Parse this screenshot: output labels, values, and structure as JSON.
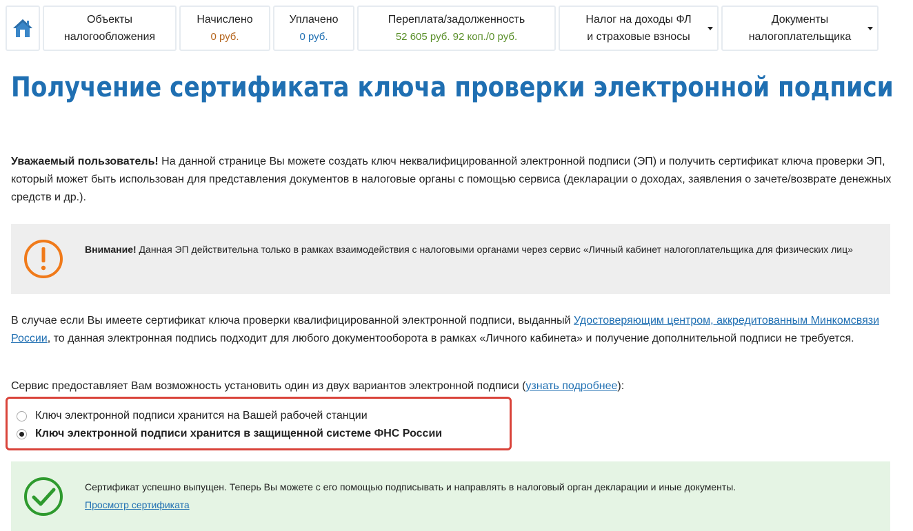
{
  "nav": {
    "home_label": "home",
    "objects": {
      "line1": "Объекты",
      "line2": "налогообложения"
    },
    "accrued": {
      "line1": "Начислено",
      "line2": "0 руб."
    },
    "paid": {
      "line1": "Уплачено",
      "line2": "0 руб."
    },
    "balance": {
      "line1": "Переплата/задолженность",
      "line2": "52 605 руб. 92 коп./0 руб."
    },
    "tax": {
      "line1": "Налог на доходы ФЛ",
      "line2": "и страховые взносы"
    },
    "docs": {
      "line1": "Документы",
      "line2": "налогоплательщика"
    },
    "colors": {
      "accrued": "#b5651d",
      "paid": "#1f6fb2",
      "balance": "#5a8f2a",
      "home_icon": "#3a86c8"
    }
  },
  "page": {
    "title": "Получение сертификата ключа проверки электронной подписи",
    "intro_bold": "Уважаемый пользователь!",
    "intro_text": " На данной странице Вы можете создать ключ неквалифицированной электронной подписи (ЭП) и получить сертификат ключа проверки ЭП, который может быть использован для представления документов в налоговые органы с помощью сервиса (декларации о доходах, заявления о зачете/возврате денежных средств и др.).",
    "warning_bold": "Внимание!",
    "warning_text": " Данная ЭП действительна только в рамках взаимодействия с налоговыми органами через сервис «Личный кабинет налогоплательщика для физических лиц»",
    "qualified_text_1": "В случае если Вы имеете сертификат ключа проверки квалифицированной электронной подписи, выданный ",
    "qualified_link": "Удостоверяющим центром, аккредитованным Минкомсвязи России",
    "qualified_text_2": ", то данная электронная подпись подходит для любого документооборота в рамках «Личного кабинета» и получение дополнительной подписи не требуется.",
    "options_text_1": "Сервис предоставляет Вам возможность установить один из двух вариантов электронной подписи (",
    "options_link": "узнать подробнее",
    "options_text_2": "):",
    "radio_options": [
      {
        "label": "Ключ электронной подписи хранится на Вашей рабочей станции",
        "checked": false
      },
      {
        "label": "Ключ электронной подписи хранится в защищенной системе ФНС России",
        "checked": true
      }
    ],
    "success_text": "Сертификат успешно выпущен. Теперь Вы можете с его помощью подписывать и направлять в налоговый орган декларации и иные документы.",
    "success_link": "Просмотр сертификата"
  },
  "icons": {
    "home": "home-icon",
    "warning": "exclamation-circle-icon",
    "success": "check-circle-icon"
  },
  "colors": {
    "title": "#1f6fb2",
    "warning_orange": "#f07a1a",
    "success_green": "#2e9a2e",
    "highlight_red": "#d9433a"
  }
}
